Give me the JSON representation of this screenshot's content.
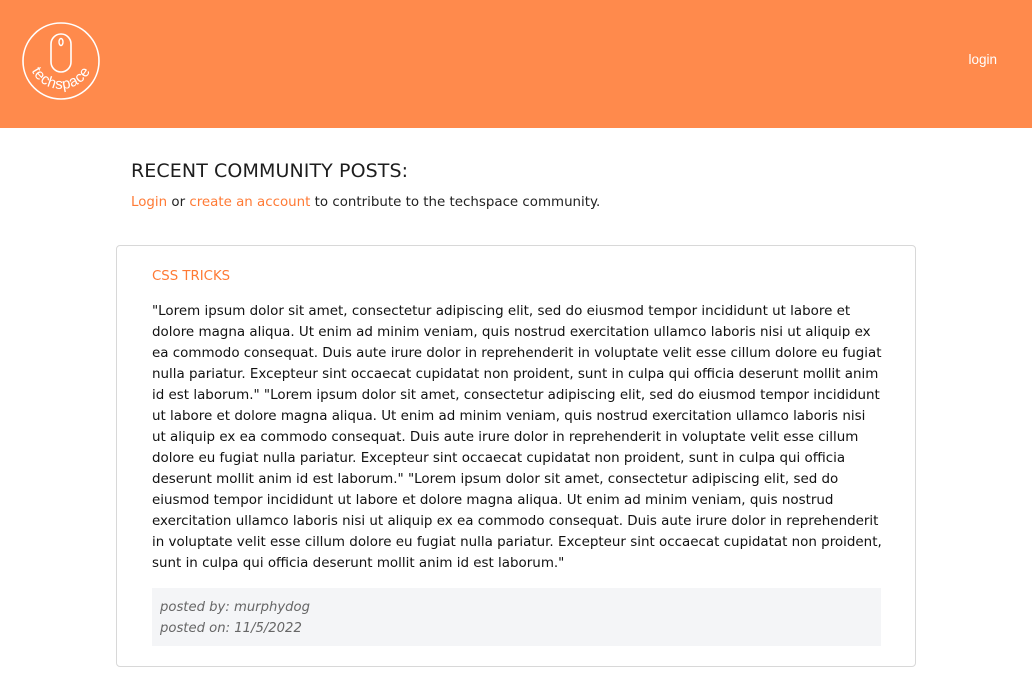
{
  "header": {
    "logo_text": "techspace",
    "login_label": "login",
    "background_color": "#ff8a4c"
  },
  "main": {
    "title": "RECENT COMMUNITY POSTS:",
    "intro": {
      "login_link": "Login",
      "or_text": " or ",
      "create_account_link": "create an account",
      "suffix_text": " to contribute to the techspace community."
    }
  },
  "posts": [
    {
      "title": "CSS TRICKS",
      "body": "\"Lorem ipsum dolor sit amet, consectetur adipiscing elit, sed do eiusmod tempor incididunt ut labore et dolore magna aliqua. Ut enim ad minim veniam, quis nostrud exercitation ullamco laboris nisi ut aliquip ex ea commodo consequat. Duis aute irure dolor in reprehenderit in voluptate velit esse cillum dolore eu fugiat nulla pariatur. Excepteur sint occaecat cupidatat non proident, sunt in culpa qui officia deserunt mollit anim id est laborum.\" \"Lorem ipsum dolor sit amet, consectetur adipiscing elit, sed do eiusmod tempor incididunt ut labore et dolore magna aliqua. Ut enim ad minim veniam, quis nostrud exercitation ullamco laboris nisi ut aliquip ex ea commodo consequat. Duis aute irure dolor in reprehenderit in voluptate velit esse cillum dolore eu fugiat nulla pariatur. Excepteur sint occaecat cupidatat non proident, sunt in culpa qui officia deserunt mollit anim id est laborum.\" \"Lorem ipsum dolor sit amet, consectetur adipiscing elit, sed do eiusmod tempor incididunt ut labore et dolore magna aliqua. Ut enim ad minim veniam, quis nostrud exercitation ullamco laboris nisi ut aliquip ex ea commodo consequat. Duis aute irure dolor in reprehenderit in voluptate velit esse cillum dolore eu fugiat nulla pariatur. Excepteur sint occaecat cupidatat non proident, sunt in culpa qui officia deserunt mollit anim id est laborum.\"",
      "posted_by": "posted by: murphydog",
      "posted_on": "posted on: 11/5/2022"
    }
  ],
  "colors": {
    "accent": "#ff7a35",
    "meta_background": "#f4f5f7",
    "card_border": "#d8d8d8"
  }
}
